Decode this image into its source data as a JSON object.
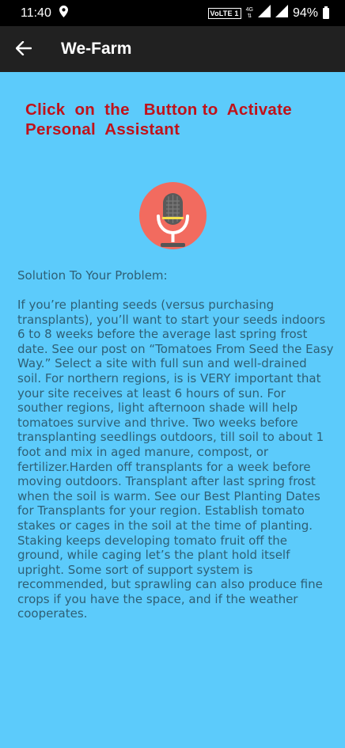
{
  "status_bar": {
    "time": "11:40",
    "volte": "VoLTE 1",
    "network": "4G",
    "battery": "94%"
  },
  "app_bar": {
    "title": "We-Farm"
  },
  "main": {
    "headline": "Click  on  the   Button to  Activate\nPersonal  Assistant",
    "solution_label": "Solution To Your Problem:",
    "solution_text": "If you’re planting seeds (versus purchasing transplants), you’ll want to start your seeds indoors 6 to 8 weeks before the average last spring frost date. See our post on “Tomatoes From Seed the Easy Way.” Select a site with full sun and well-drained soil. For northern regions, is is VERY important that your site receives at least 6 hours of sun. For souther regions, light afternoon shade will help tomatoes survive and thrive. Two weeks before transplanting seedlings outdoors, till soil to about 1 foot and mix in aged manure, compost, or fertilizer.Harden off transplants for a week before moving outdoors. Transplant after last spring frost when the soil is warm. See our Best Planting Dates for Transplants for your region. Establish tomato stakes or cages in the soil at the time of planting. Staking keeps developing tomato fruit off the ground, while caging let’s the plant hold itself upright. Some sort of support system is recommended, but sprawling can also produce fine crops if you have the space, and if the weather cooperates."
  },
  "colors": {
    "background": "#5ccbfb",
    "app_bar": "#212121",
    "headline": "#c0121a",
    "mic_circle": "#f26b5f",
    "body_text": "#2f5f75"
  },
  "icons": {
    "back": "arrow-left-icon",
    "location": "location-pin-icon",
    "signal": "signal-icon",
    "battery": "battery-icon",
    "mic": "microphone-icon"
  }
}
